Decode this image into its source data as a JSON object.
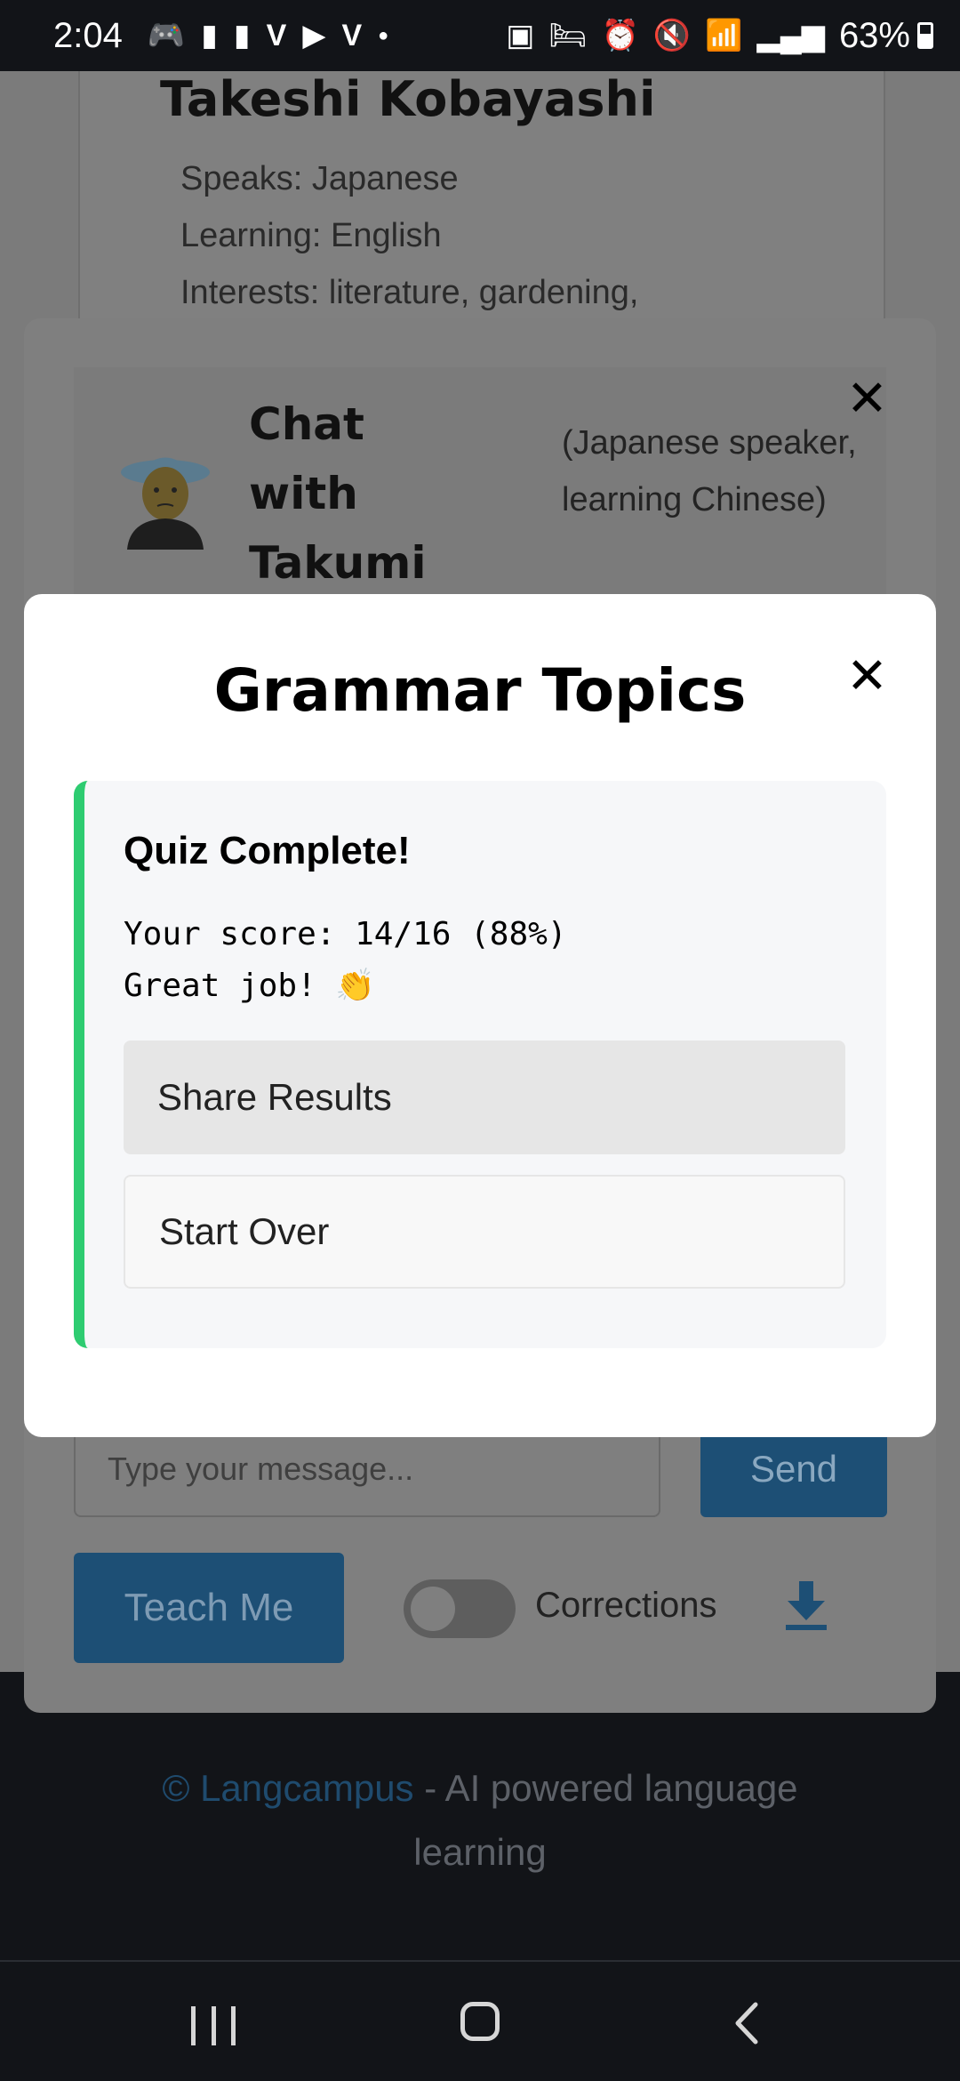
{
  "status_bar": {
    "time": "2:04",
    "left_icons": [
      "game-controller-icon",
      "cup-icon",
      "cup-icon",
      "v-app-icon",
      "youtube-icon",
      "v-app-icon",
      "dot-icon"
    ],
    "right_icons": [
      "battery-saver-icon",
      "bed-icon",
      "alarm-icon",
      "mute-icon",
      "wifi-icon",
      "signal-icon"
    ],
    "battery_percent": "63%"
  },
  "background_profile": {
    "name": "Takeshi Kobayashi",
    "speaks": "Speaks: Japanese",
    "learning": "Learning: English",
    "interests": "Interests: literature, gardening,"
  },
  "chat_modal": {
    "title": "Chat with Takumi Yamada",
    "subtitle": "(Japanese speaker, learning Chinese)",
    "close_symbol": "✕",
    "message_placeholder": "Type your message...",
    "send_label": "Send",
    "teach_label": "Teach Me",
    "corrections_label": "Corrections",
    "corrections_enabled": false
  },
  "grammar_modal": {
    "title": "Grammar Topics",
    "close_symbol": "✕",
    "quiz": {
      "heading": "Quiz Complete!",
      "score_line": "Your score: 14/16 (88%)",
      "message_line": "Great job! 👏",
      "share_label": "Share Results",
      "start_over_label": "Start Over"
    }
  },
  "footer": {
    "copyright": "©",
    "brand": "Langcampus",
    "tagline": " - AI powered language learning"
  },
  "colors": {
    "accent_green": "#2ecc71",
    "button_blue": "#2980b9"
  }
}
